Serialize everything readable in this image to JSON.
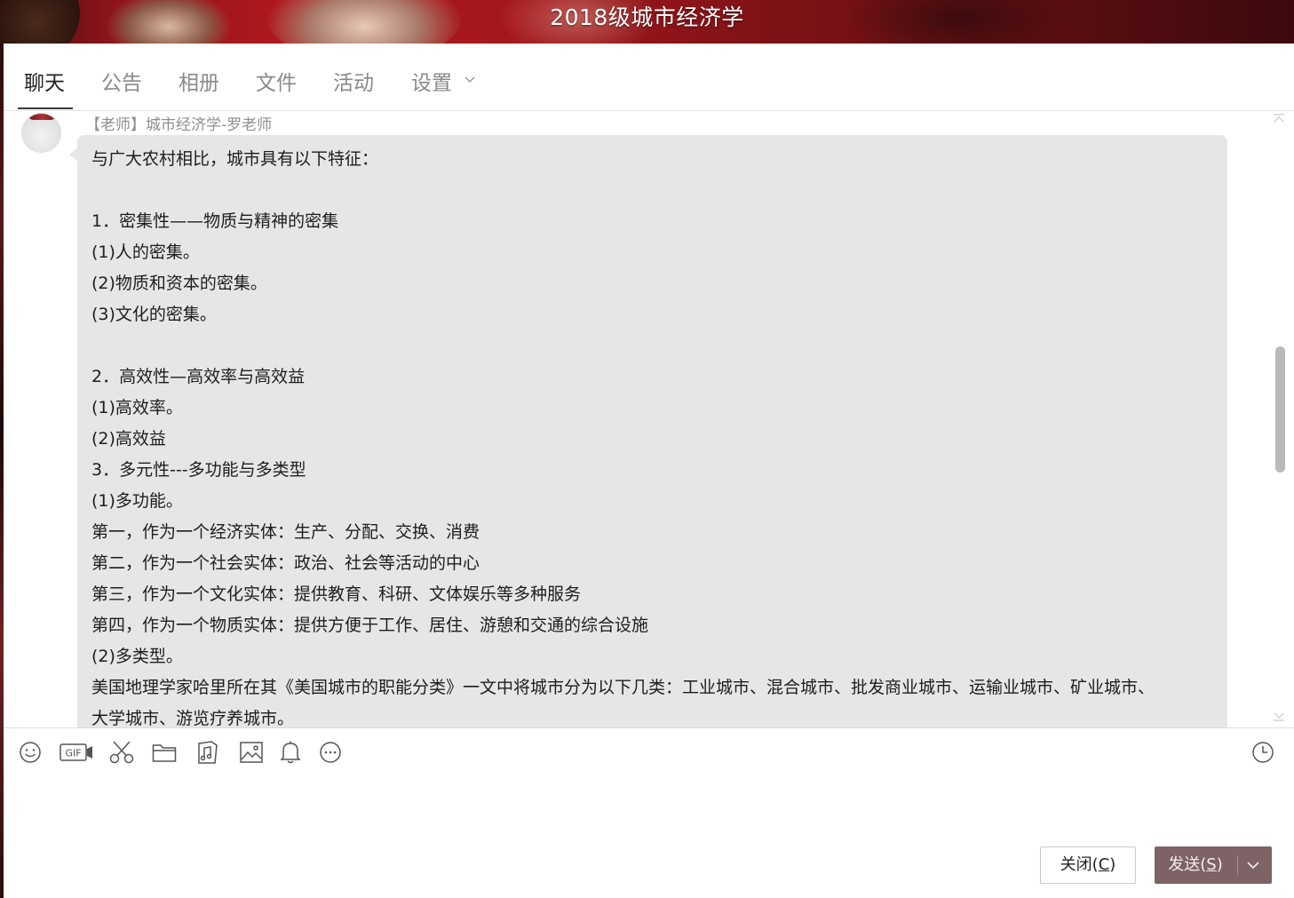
{
  "window": {
    "title": "2018级城市经济学"
  },
  "tabs": [
    {
      "label": "聊天",
      "active": true
    },
    {
      "label": "公告",
      "active": false
    },
    {
      "label": "相册",
      "active": false
    },
    {
      "label": "文件",
      "active": false
    },
    {
      "label": "活动",
      "active": false
    },
    {
      "label": "设置",
      "active": false
    }
  ],
  "message": {
    "sender": "【老师】城市经济学-罗老师",
    "lines": [
      "与广大农村相比，城市具有以下特征：",
      "",
      "1．密集性——物质与精神的密集",
      "(1)人的密集。",
      "(2)物质和资本的密集。",
      "(3)文化的密集。",
      "",
      "2．高效性—高效率与高效益",
      "(1)高效率。",
      "(2)高效益",
      "3．多元性---多功能与多类型",
      "(1)多功能。",
      "第一，作为一个经济实体：生产、分配、交换、消费",
      "第二，作为一个社会实体：政治、社会等活动的中心",
      "第三，作为一个文化实体：提供教育、科研、文体娱乐等多种服务",
      "第四，作为一个物质实体：提供方便于工作、居住、游憩和交通的综合设施",
      "(2)多类型。",
      "美国地理学家哈里所在其《美国城市的职能分类》一文中将城市分为以下几类：工业城市、混合城市、批发商业城市、运输业城市、矿业城市、",
      "大学城市、游览疗养城市。"
    ]
  },
  "toolbar": {
    "icons": [
      "emoji-icon",
      "gif-icon",
      "screenshot-scissors-icon",
      "folder-icon",
      "music-icon",
      "image-icon",
      "bell-icon",
      "more-icon"
    ],
    "gif_text": "GIF",
    "history_icon": "clock-icon"
  },
  "input": {
    "value": ""
  },
  "buttons": {
    "close_label": "关闭(",
    "close_key": "C",
    "close_suffix": ")",
    "send_label": "发送(",
    "send_key": "S",
    "send_suffix": ")"
  },
  "colors": {
    "banner": "#a3171b",
    "bubble": "#e6e6e6",
    "send_button": "#7d6266",
    "active_tab": "#222222",
    "inactive_tab": "#8a8a8a"
  }
}
